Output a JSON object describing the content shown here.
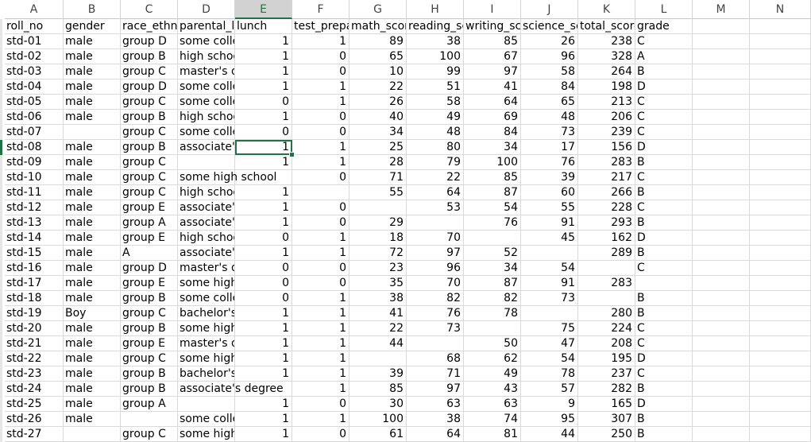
{
  "columns": [
    "A",
    "B",
    "C",
    "D",
    "E",
    "F",
    "G",
    "H",
    "I",
    "J",
    "K",
    "L",
    "M",
    "N"
  ],
  "selected_column": "E",
  "selected_cell": {
    "row": 8,
    "col": "E"
  },
  "rows": [
    [
      "roll_no",
      "gender",
      "race_ethnicity",
      "parental_level_of_education",
      "lunch",
      "test_preparation_course",
      "math_score",
      "reading_score",
      "writing_score",
      "science_score",
      "total_score",
      "grade"
    ],
    [
      "std-01",
      "male",
      "group D",
      "some college",
      "1",
      "1",
      "89",
      "38",
      "85",
      "26",
      "238",
      "C"
    ],
    [
      "std-02",
      "male",
      "group B",
      "high school",
      "1",
      "0",
      "65",
      "100",
      "67",
      "96",
      "328",
      "A"
    ],
    [
      "std-03",
      "male",
      "group C",
      "master's degree",
      "1",
      "0",
      "10",
      "99",
      "97",
      "58",
      "264",
      "B"
    ],
    [
      "std-04",
      "male",
      "group D",
      "some college",
      "1",
      "1",
      "22",
      "51",
      "41",
      "84",
      "198",
      "D"
    ],
    [
      "std-05",
      "male",
      "group C",
      "some college",
      "0",
      "1",
      "26",
      "58",
      "64",
      "65",
      "213",
      "C"
    ],
    [
      "std-06",
      "male",
      "group B",
      "high school",
      "1",
      "0",
      "40",
      "49",
      "69",
      "48",
      "206",
      "C"
    ],
    [
      "std-07",
      "",
      "group C",
      "some college",
      "0",
      "0",
      "34",
      "48",
      "84",
      "73",
      "239",
      "C"
    ],
    [
      "std-08",
      "male",
      "group B",
      "associate's degree",
      "1",
      "1",
      "25",
      "80",
      "34",
      "17",
      "156",
      "D"
    ],
    [
      "std-09",
      "male",
      "group C",
      "",
      "1",
      "1",
      "28",
      "79",
      "100",
      "76",
      "283",
      "B"
    ],
    [
      "std-10",
      "male",
      "group C",
      "some high school",
      "",
      "0",
      "71",
      "22",
      "85",
      "39",
      "217",
      "C"
    ],
    [
      "std-11",
      "male",
      "group C",
      "high school",
      "1",
      "",
      "55",
      "64",
      "87",
      "60",
      "266",
      "B"
    ],
    [
      "std-12",
      "male",
      "group E",
      "associate's degree",
      "1",
      "0",
      "",
      "53",
      "54",
      "55",
      "228",
      "C"
    ],
    [
      "std-13",
      "male",
      "group A",
      "associate's degree",
      "1",
      "0",
      "29",
      "",
      "76",
      "91",
      "293",
      "B"
    ],
    [
      "std-14",
      "male",
      "group E",
      "high school",
      "0",
      "1",
      "18",
      "70",
      "",
      "45",
      "162",
      "D"
    ],
    [
      "std-15",
      "male",
      "A",
      "associate's degree",
      "1",
      "1",
      "72",
      "97",
      "52",
      "",
      "289",
      "B"
    ],
    [
      "std-16",
      "male",
      "group D",
      "master's degree",
      "0",
      "0",
      "23",
      "96",
      "34",
      "54",
      "",
      "C"
    ],
    [
      "std-17",
      "male",
      "group E",
      "some high school",
      "0",
      "0",
      "35",
      "70",
      "87",
      "91",
      "283",
      ""
    ],
    [
      "std-18",
      "male",
      "group B",
      "some college",
      "0",
      "1",
      "38",
      "82",
      "82",
      "73",
      "",
      "B"
    ],
    [
      "std-19",
      "Boy",
      "group C",
      "bachelor's degree",
      "1",
      "1",
      "41",
      "76",
      "78",
      "",
      "280",
      "B"
    ],
    [
      "std-20",
      "male",
      "group B",
      "some high school",
      "1",
      "1",
      "22",
      "73",
      "",
      "75",
      "224",
      "C"
    ],
    [
      "std-21",
      "male",
      "group E",
      "master's degree",
      "1",
      "1",
      "44",
      "",
      "50",
      "47",
      "208",
      "C"
    ],
    [
      "std-22",
      "male",
      "group C",
      "some high school",
      "1",
      "1",
      "",
      "68",
      "62",
      "54",
      "195",
      "D"
    ],
    [
      "std-23",
      "male",
      "group B",
      "bachelor's degree",
      "1",
      "1",
      "39",
      "71",
      "49",
      "78",
      "237",
      "C"
    ],
    [
      "std-24",
      "male",
      "group B",
      "associate's degree",
      "",
      "1",
      "85",
      "97",
      "43",
      "57",
      "282",
      "B"
    ],
    [
      "std-25",
      "male",
      "group A",
      "",
      "1",
      "0",
      "30",
      "63",
      "63",
      "9",
      "165",
      "D"
    ],
    [
      "std-26",
      "male",
      "",
      "some college",
      "1",
      "1",
      "100",
      "38",
      "74",
      "95",
      "307",
      "B"
    ],
    [
      "std-27",
      "",
      "group C",
      "some high school",
      "1",
      "0",
      "61",
      "64",
      "81",
      "44",
      "250",
      "B"
    ]
  ]
}
